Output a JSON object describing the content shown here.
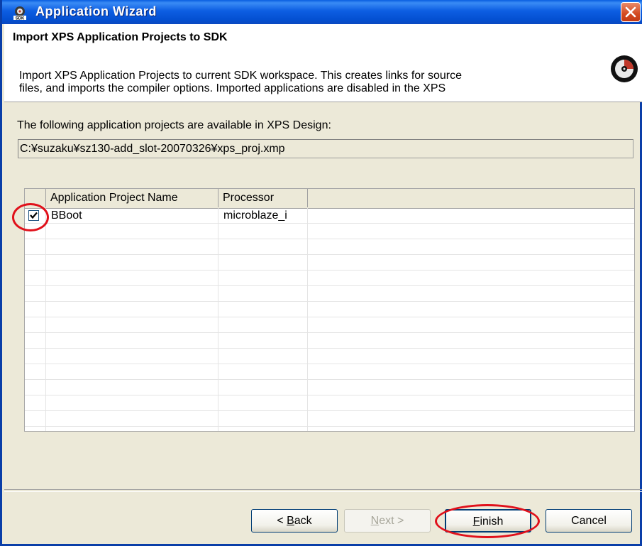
{
  "window": {
    "title": "Application Wizard"
  },
  "banner": {
    "title": "Import XPS Application Projects to SDK",
    "description_lines": [
      "Import XPS Application Projects to current SDK workspace. This creates links for source",
      "files, and imports the compiler options. Imported applications are disabled in the XPS"
    ]
  },
  "body": {
    "available_label": "The following application projects are available in XPS Design:",
    "xmp_path": "C:¥suzaku¥sz130-add_slot-20070326¥xps_proj.xmp"
  },
  "table": {
    "columns": [
      "",
      "Application Project Name",
      "Processor",
      ""
    ],
    "rows": [
      {
        "checked": true,
        "name": "BBoot",
        "processor": "microblaze_i"
      }
    ]
  },
  "buttons": {
    "back": {
      "prefix": "< ",
      "mnemonic": "B",
      "rest": "ack"
    },
    "next": {
      "mnemonic": "N",
      "rest": "ext >"
    },
    "finish": {
      "mnemonic": "F",
      "rest": "inish"
    },
    "cancel": "Cancel"
  },
  "colors": {
    "titlebar": "#0450d2",
    "annotation": "#e0101a",
    "window_bg": "#ece9d8"
  }
}
